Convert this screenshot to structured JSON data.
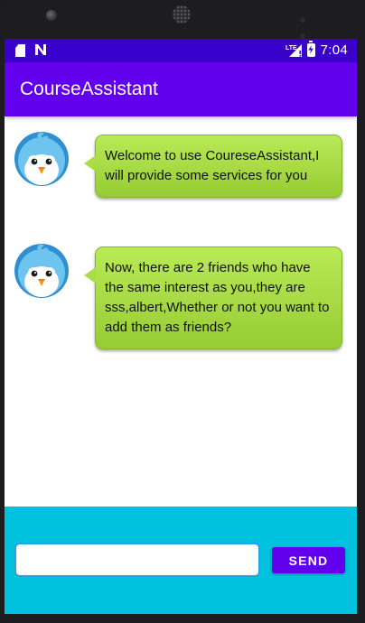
{
  "app": {
    "title": "CourseAssistant",
    "accent_color": "#6200ee",
    "statusbar_color": "#3a00cc",
    "bottom_bar_color": "#00c2de",
    "bubble_color": "#a9dc47"
  },
  "statusbar": {
    "left_icons": [
      "sd-card-icon",
      "n-notification-icon"
    ],
    "right_icons": [
      "lte-signal-icon",
      "battery-charging-icon"
    ],
    "lte_label": "LTE",
    "time": "7:04"
  },
  "messages": [
    {
      "sender": "bot",
      "avatar_icon": "bird-avatar-icon",
      "text": "Welcome to use CoureseAssistant,I will provide some services for you"
    },
    {
      "sender": "bot",
      "avatar_icon": "bird-avatar-icon",
      "text": "Now, there are 2 friends who have the same interest as you,they are sss,albert,Whether or not you want to add them as friends?"
    }
  ],
  "composer": {
    "input_value": "",
    "input_placeholder": "",
    "send_label": "SEND"
  }
}
